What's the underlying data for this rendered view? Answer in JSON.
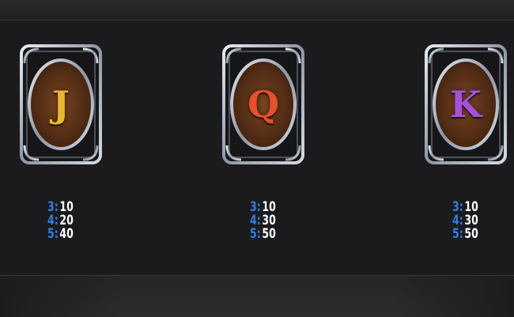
{
  "colors": {
    "count_blue": "#2f7fe6",
    "amount_white": "#ffffff",
    "frame_silver": "#b8c2cc",
    "wood_brown": "#5a3218"
  },
  "symbols": [
    {
      "id": "J",
      "letter": "J",
      "letter_color": "#e9b82e",
      "pays": [
        {
          "count": "3:",
          "amount": "10"
        },
        {
          "count": "4:",
          "amount": "20"
        },
        {
          "count": "5:",
          "amount": "40"
        }
      ]
    },
    {
      "id": "Q",
      "letter": "Q",
      "letter_color": "#e6502a",
      "pays": [
        {
          "count": "3:",
          "amount": "10"
        },
        {
          "count": "4:",
          "amount": "30"
        },
        {
          "count": "5:",
          "amount": "50"
        }
      ]
    },
    {
      "id": "K",
      "letter": "K",
      "letter_color": "#a94fe0",
      "pays": [
        {
          "count": "3:",
          "amount": "10"
        },
        {
          "count": "4:",
          "amount": "30"
        },
        {
          "count": "5:",
          "amount": "50"
        }
      ]
    }
  ]
}
